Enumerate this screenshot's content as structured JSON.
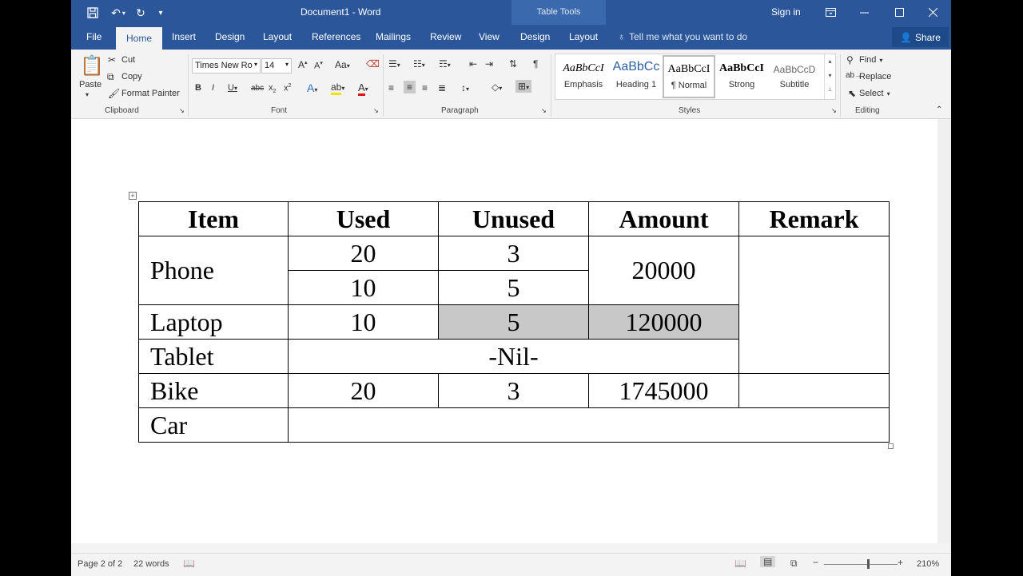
{
  "titlebar": {
    "document_title": "Document1 - Word",
    "contextual_group": "Table Tools",
    "sign_in": "Sign in",
    "qa_icons": [
      "save-icon",
      "undo-icon",
      "redo-icon",
      "customize-icon"
    ]
  },
  "tabs": {
    "file": "File",
    "home": "Home",
    "insert": "Insert",
    "design": "Design",
    "layout": "Layout",
    "references": "References",
    "mailings": "Mailings",
    "review": "Review",
    "view": "View",
    "table_design": "Design",
    "table_layout": "Layout",
    "tell_me": "Tell me what you want to do",
    "share": "Share"
  },
  "ribbon": {
    "clipboard": {
      "label": "Clipboard",
      "paste": "Paste",
      "cut": "Cut",
      "copy": "Copy",
      "format_painter": "Format Painter"
    },
    "font": {
      "label": "Font",
      "font_name": "Times New Ro",
      "font_size": "14"
    },
    "paragraph": {
      "label": "Paragraph"
    },
    "styles": {
      "label": "Styles",
      "items": [
        {
          "preview": "AaBbCcI",
          "name": "Emphasis"
        },
        {
          "preview": "AaBbCc",
          "name": "Heading 1"
        },
        {
          "preview": "AaBbCcI",
          "name": "¶ Normal"
        },
        {
          "preview": "AaBbCcI",
          "name": "Strong"
        },
        {
          "preview": "AaBbCcD",
          "name": "Subtitle"
        }
      ]
    },
    "editing": {
      "label": "Editing",
      "find": "Find",
      "replace": "Replace",
      "select": "Select"
    }
  },
  "table": {
    "headers": [
      "Item",
      "Used",
      "Unused",
      "Amount",
      "Remark"
    ],
    "phone": {
      "item": "Phone",
      "used_1": "20",
      "unused_1": "3",
      "amount": "20000",
      "used_2": "10",
      "unused_2": "5"
    },
    "laptop": {
      "item": "Laptop",
      "used": "10",
      "unused": "5",
      "amount": "120000"
    },
    "tablet": {
      "item": "Tablet",
      "merged": "-Nil-"
    },
    "bike": {
      "item": "Bike",
      "used": "20",
      "unused": "3",
      "amount": "1745000"
    },
    "car": {
      "item": "Car"
    }
  },
  "statusbar": {
    "page": "Page 2 of 2",
    "words": "22 words",
    "zoom": "210%"
  },
  "colors": {
    "brand": "#2b579a",
    "shade": "#c8c8c8"
  }
}
